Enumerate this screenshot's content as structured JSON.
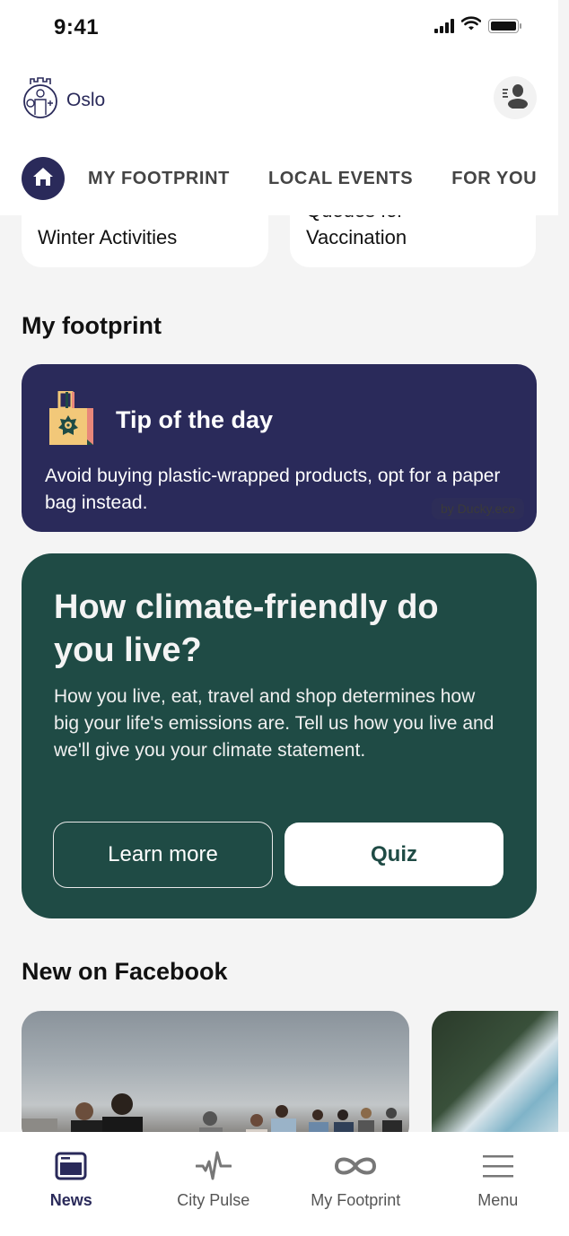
{
  "status_bar": {
    "time": "9:41"
  },
  "header": {
    "brand_name": "Oslo",
    "brand_icon": "oslo-coat-of-arms-icon",
    "profile_icon": "user-profile-icon"
  },
  "tabs": {
    "home_icon": "home-icon",
    "items": [
      {
        "label": "MY FOOTPRINT"
      },
      {
        "label": "LOCAL EVENTS"
      },
      {
        "label": "FOR YOU"
      }
    ]
  },
  "top_cards": [
    {
      "title_line1": "Winter Activities",
      "title_line2": ""
    },
    {
      "title_line1": "Queues for",
      "title_line2": "Vaccination"
    }
  ],
  "footprint": {
    "section_title": "My footprint",
    "tip": {
      "icon": "shopping-bag-icon",
      "title": "Tip of the day",
      "body": "Avoid buying plastic-wrapped products, opt for a paper bag instead.",
      "credit": "by Ducky.eco"
    },
    "quiz": {
      "title": "How climate-friendly do you live?",
      "body": "How you live, eat, travel and shop determines how big your life's emissions are. Tell us how you live and we'll give you your climate statement.",
      "learn_more": "Learn more",
      "quiz_button": "Quiz"
    }
  },
  "facebook": {
    "section_title": "New on Facebook",
    "posts": [
      {
        "image": "group-of-people-dancing-outdoors"
      },
      {
        "image": "person-holding-magazine"
      }
    ]
  },
  "bottom_nav": [
    {
      "label": "News",
      "icon": "news-icon",
      "active": true
    },
    {
      "label": "City Pulse",
      "icon": "pulse-icon",
      "active": false
    },
    {
      "label": "My Footprint",
      "icon": "infinity-icon",
      "active": false
    },
    {
      "label": "Menu",
      "icon": "hamburger-menu-icon",
      "active": false
    }
  ],
  "colors": {
    "brand_navy": "#2a2a5a",
    "forest_green": "#1f4b45",
    "background": "#f4f4f4",
    "bag_yellow": "#f2c879",
    "bag_pink": "#e8877a"
  }
}
